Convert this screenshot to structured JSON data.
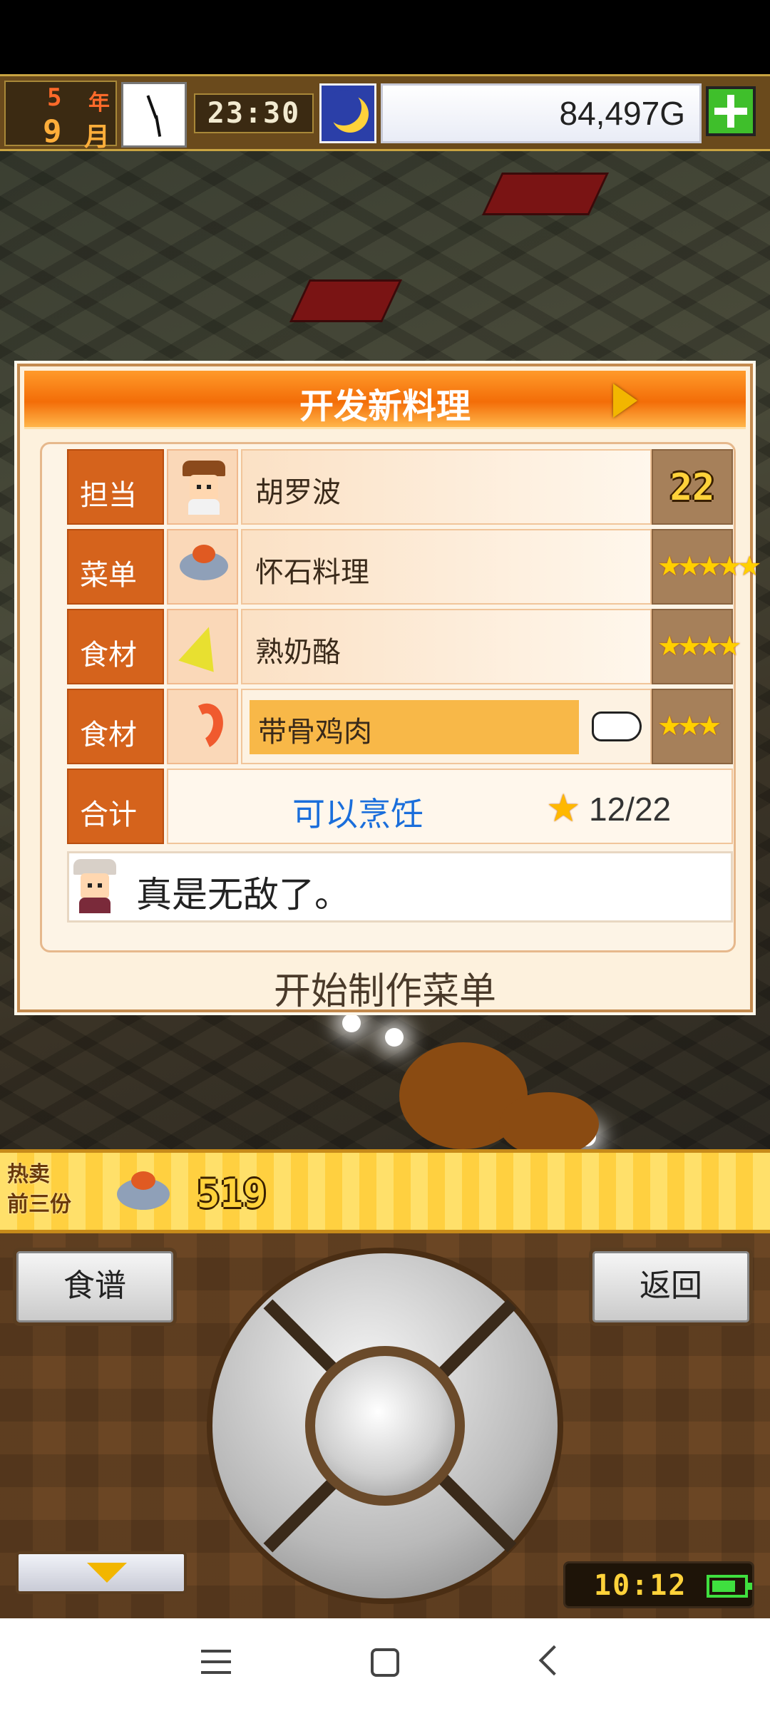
{
  "hud": {
    "year_value": "5",
    "year_unit": "年",
    "month_value": "9",
    "month_unit": "月",
    "time": "23:30",
    "money": "84,497G",
    "icons": [
      "clock-icon",
      "moon-icon",
      "plus-icon"
    ]
  },
  "dialog": {
    "title": "开发新料理",
    "rows": [
      {
        "label": "担当",
        "value": "胡罗波",
        "rank": "22",
        "icon": "chef-portrait-icon"
      },
      {
        "label": "菜单",
        "value": "怀石料理",
        "stars": "★★★★★",
        "icon": "dish-icon"
      },
      {
        "label": "食材",
        "value": "熟奶酪",
        "stars": "★★★★",
        "icon": "cheese-icon"
      },
      {
        "label": "食材",
        "value": "带骨鸡肉",
        "stars": "★★★",
        "icon": "drumstick-icon",
        "selected": true
      }
    ],
    "total": {
      "label": "合计",
      "status": "可以烹饪",
      "score": "12/22",
      "star": "★"
    },
    "message": "真是无敌了。",
    "footer": "开始制作菜单"
  },
  "best_sellers": {
    "label_line1": "热卖",
    "label_line2": "前三份",
    "count": "519"
  },
  "controls": {
    "recipe_label": "食谱",
    "back_label": "返回",
    "device_time": "10:12"
  },
  "colors": {
    "title_orange": "#f36d08",
    "label_orange": "#d5631c",
    "cook_blue": "#1a6edb",
    "selected_highlight": "#f8b848"
  }
}
